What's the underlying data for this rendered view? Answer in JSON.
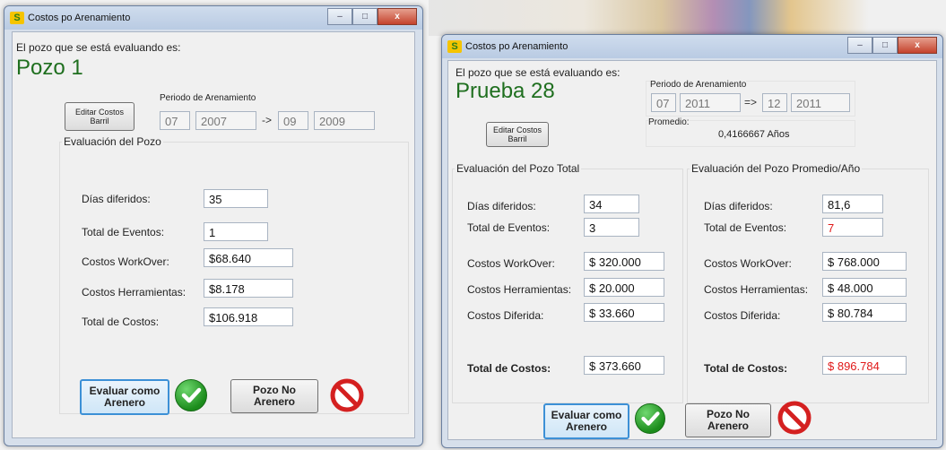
{
  "win1": {
    "title": "Costos po Arenamiento",
    "app_icon_text": "S",
    "prompt": "El pozo que se está evaluando es:",
    "well_name": "Pozo 1",
    "edit_button": "Editar Costos Barril",
    "period_label": "Periodo de Arenamiento",
    "period": {
      "m1": "07",
      "y1": "2007",
      "sep": "->",
      "m2": "09",
      "y2": "2009"
    },
    "group_title": "Evaluación del Pozo",
    "fields": [
      {
        "label": "Días diferidos:",
        "value": "35"
      },
      {
        "label": "Total de Eventos:",
        "value": "1"
      },
      {
        "label": "Costos WorkOver:",
        "value": "$68.640"
      },
      {
        "label": "Costos Herramientas:",
        "value": "$8.178"
      },
      {
        "label": "Total de Costos:",
        "value": "$106.918"
      }
    ],
    "btn_sand": "Evaluar como Arenero",
    "btn_no_sand": "Pozo No Arenero"
  },
  "win2": {
    "title": "Costos po Arenamiento",
    "app_icon_text": "S",
    "prompt": "El pozo que se está evaluando es:",
    "well_name": "Prueba 28",
    "edit_button": "Editar Costos Barril",
    "period_label": "Periodo de Arenamiento",
    "period": {
      "m1": "07",
      "y1": "2011",
      "sep": "=>",
      "m2": "12",
      "y2": "2011"
    },
    "avg_label": "Promedio:",
    "avg_value": "0,4166667 Años",
    "group_total_title": "Evaluación del Pozo Total",
    "group_avg_title": "Evaluación del Pozo Promedio/Año",
    "labels": [
      "Días diferidos:",
      "Total de Eventos:",
      "Costos WorkOver:",
      "Costos Herramientas:",
      "Costos Diferida:",
      "Total de Costos:"
    ],
    "total_values": [
      "34",
      "3",
      "$ 320.000",
      "$ 20.000",
      "$ 33.660",
      "$ 373.660"
    ],
    "avg_values": [
      "81,6",
      "7",
      "$ 768.000",
      "$ 48.000",
      "$ 80.784",
      "$ 896.784"
    ],
    "btn_sand": "Evaluar como Arenero",
    "btn_no_sand": "Pozo No Arenero"
  },
  "window_buttons": {
    "min": "–",
    "max": "□",
    "close": "x"
  },
  "colors": {
    "well_name": "#1f6f1f",
    "warning_value": "#e01818",
    "focus_border": "#3c90d6"
  }
}
